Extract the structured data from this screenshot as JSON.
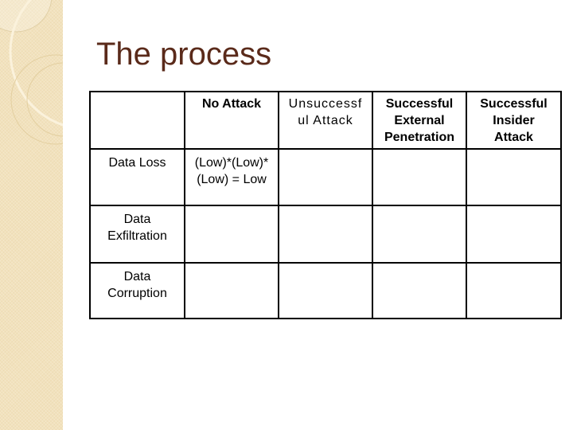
{
  "slide": {
    "title": "The process",
    "colors": {
      "title": "#5a2a1a",
      "sidebar": "#f2e2bd",
      "border": "#000000"
    }
  },
  "table": {
    "headers": [
      "",
      "No Attack",
      "Unsuccessful Attack",
      "Successful External Penetration",
      "Successful Insider Attack"
    ],
    "header_display": {
      "col2_line1": "Unsuccessf",
      "col2_line2": "ul Attack",
      "col3_line1": "Successful",
      "col3_line2": "External",
      "col3_line3": "Penetration",
      "col4_line1": "Successful",
      "col4_line2": "Insider",
      "col4_line3": "Attack"
    },
    "rows": [
      {
        "label": "Data Loss",
        "label_line1": "Data Loss",
        "cells": [
          "(Low)*(Low)*(Low) = Low",
          "",
          "",
          ""
        ],
        "cell0_line1": "(Low)*(Low)*",
        "cell0_line2": "(Low) = Low"
      },
      {
        "label": "Data Exfiltration",
        "label_line1": "Data",
        "label_line2": "Exfiltration",
        "cells": [
          "",
          "",
          "",
          ""
        ]
      },
      {
        "label": "Data Corruption",
        "label_line1": "Data",
        "label_line2": "Corruption",
        "cells": [
          "",
          "",
          "",
          ""
        ]
      }
    ]
  }
}
